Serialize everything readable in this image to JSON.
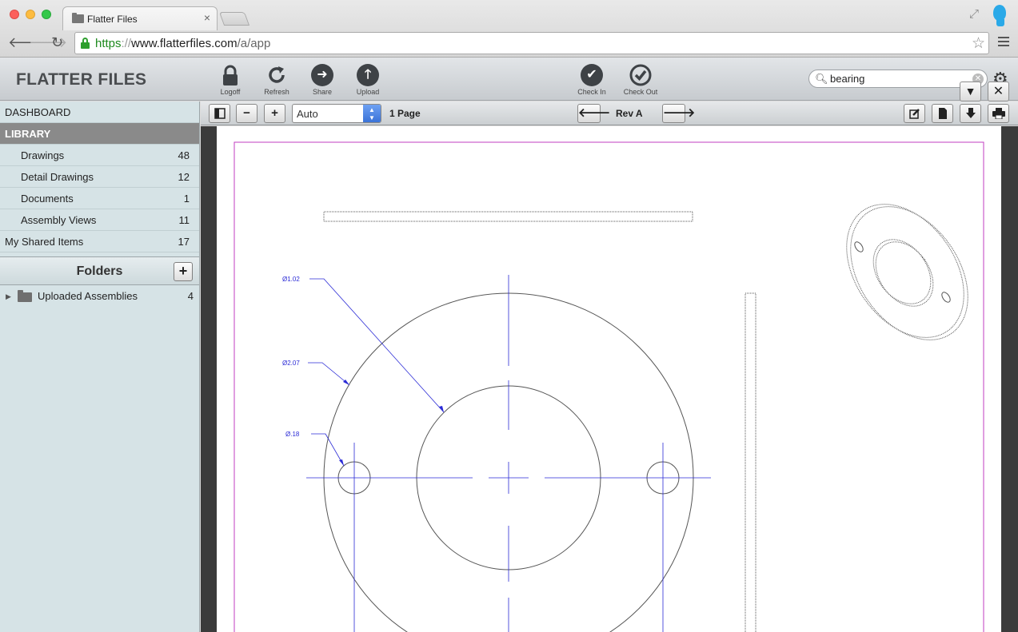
{
  "browser": {
    "tab_title": "Flatter Files",
    "tab_close": "×",
    "url_scheme": "https",
    "url_sep": "://",
    "url_host": "www.flatterfiles.com",
    "url_path": "/a/app"
  },
  "header": {
    "brand": "FLATTER FILES",
    "tools": {
      "logoff": "Logoff",
      "refresh": "Refresh",
      "share": "Share",
      "upload": "Upload",
      "check_in": "Check In",
      "check_out": "Check Out"
    },
    "search_value": "bearing"
  },
  "sidebar": {
    "dashboard": "DASHBOARD",
    "library": "LIBRARY",
    "items": [
      {
        "label": "Drawings",
        "count": "48"
      },
      {
        "label": "Detail Drawings",
        "count": "12"
      },
      {
        "label": "Documents",
        "count": "1"
      },
      {
        "label": "Assembly Views",
        "count": "11"
      }
    ],
    "shared": {
      "label": "My Shared Items",
      "count": "17"
    },
    "folders_title": "Folders",
    "folders": [
      {
        "label": "Uploaded Assemblies",
        "count": "4"
      }
    ]
  },
  "viewer": {
    "zoom": "Auto",
    "pages": "1 Page",
    "revision": "Rev A"
  },
  "drawing": {
    "dim_large": "Ø1.02",
    "dim_outer": "Ø2.07",
    "dim_hole": "Ø.18"
  },
  "colors": {
    "accent_blue": "#3a73d8",
    "dimension_blue": "#2b2bd6",
    "border_magenta": "#c13cc1",
    "library_active": "#8a8a8a"
  }
}
